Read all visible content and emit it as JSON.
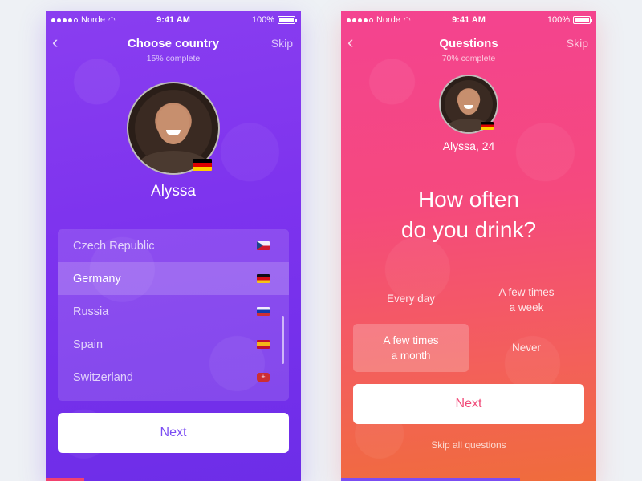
{
  "status_bar": {
    "carrier": "Norde",
    "time": "9:41 AM",
    "battery": "100%"
  },
  "screen1": {
    "title": "Choose country",
    "subtitle": "15% complete",
    "skip_label": "Skip",
    "profile_name": "Alyssa",
    "countries": [
      {
        "name": "Czech Republic",
        "flag": "flag-cz-icon",
        "selected": false
      },
      {
        "name": "Germany",
        "flag": "flag-de-icon",
        "selected": true
      },
      {
        "name": "Russia",
        "flag": "flag-ru-icon",
        "selected": false
      },
      {
        "name": "Spain",
        "flag": "flag-es-icon",
        "selected": false
      },
      {
        "name": "Switzerland",
        "flag": "flag-ch-icon",
        "selected": false
      }
    ],
    "next_label": "Next",
    "progress": 0.15,
    "accent_color": "#7b4df3",
    "progress_color": "#f2416e"
  },
  "screen2": {
    "title": "Questions",
    "subtitle": "70% complete",
    "skip_label": "Skip",
    "profile_name": "Alyssa, 24",
    "question_line1": "How often",
    "question_line2": "do you drink?",
    "answers": {
      "every_day": "Every day",
      "few_week_1": "A few times",
      "few_week_2": "a week",
      "few_month_1": "A few times",
      "few_month_2": "a month",
      "never": "Never"
    },
    "selected_answer": "A few times a month",
    "next_label": "Next",
    "skip_all_label": "Skip all questions",
    "progress": 0.7,
    "accent_color": "#f04a78",
    "progress_color": "#7b4df3"
  }
}
